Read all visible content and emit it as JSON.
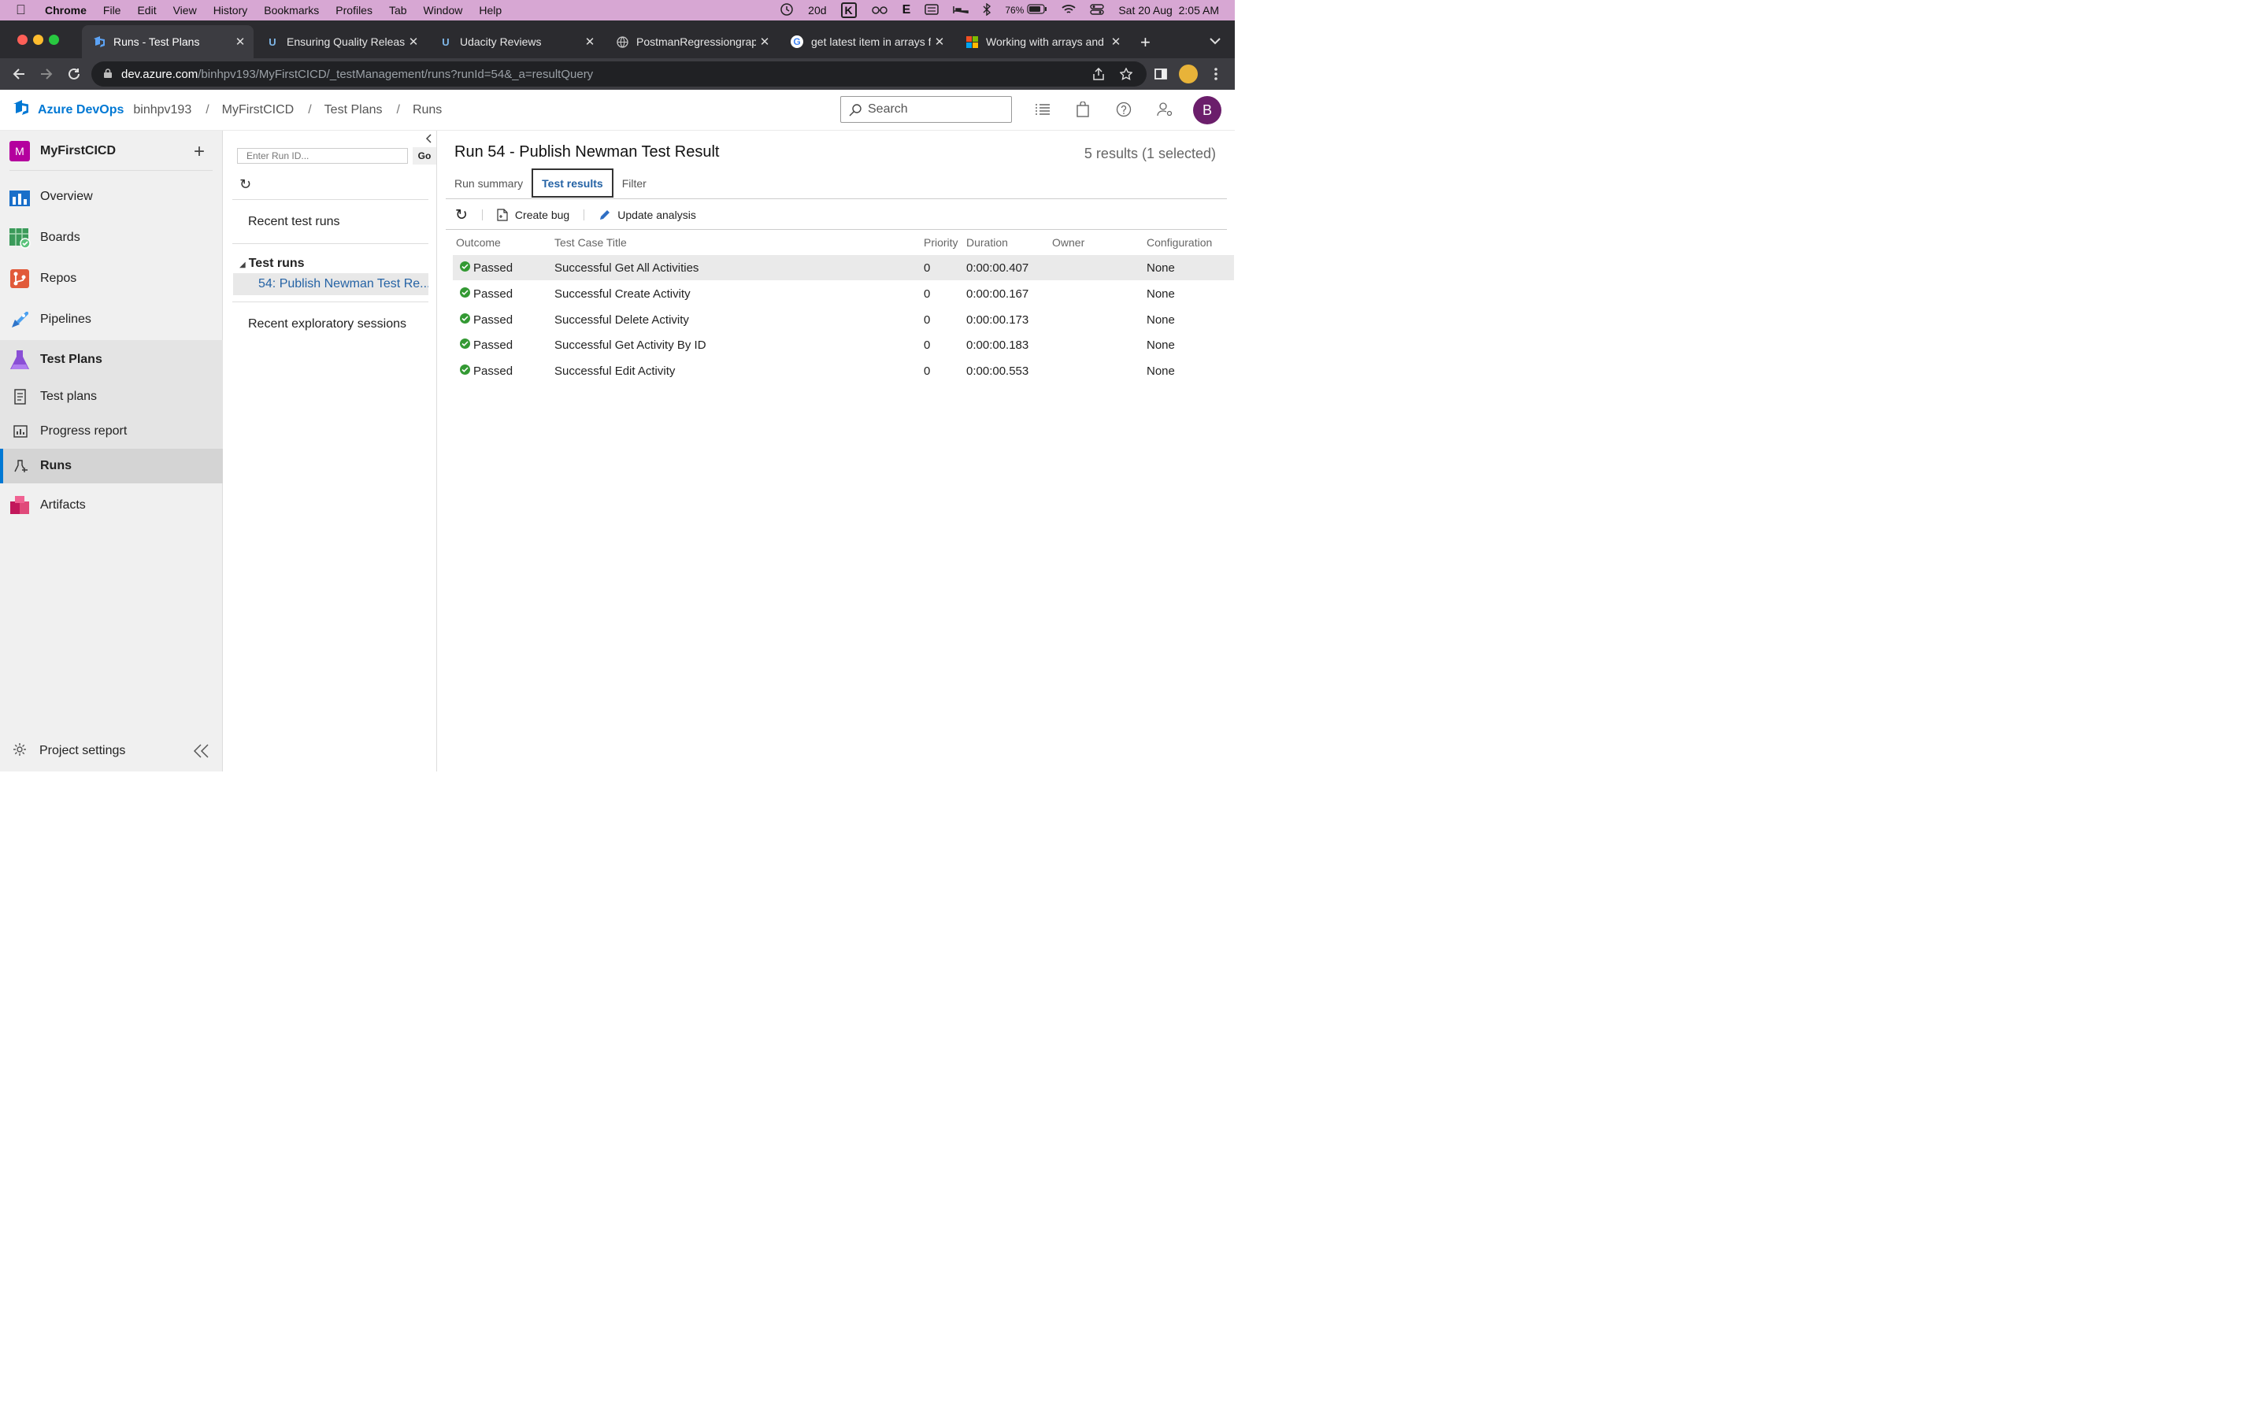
{
  "menubar": {
    "app": "Chrome",
    "items": [
      "File",
      "Edit",
      "View",
      "History",
      "Bookmarks",
      "Profiles",
      "Tab",
      "Window",
      "Help"
    ],
    "status_days": "20d",
    "status_k": "K",
    "status_e": "E",
    "battery": "76%",
    "clock": "Sat 20 Aug  2:05 AM"
  },
  "tabs": [
    {
      "title": "Runs - Test Plans",
      "icon": "azure-devops-icon"
    },
    {
      "title": "Ensuring Quality Release",
      "icon": "udacity-icon"
    },
    {
      "title": "Udacity Reviews",
      "icon": "udacity-icon"
    },
    {
      "title": "PostmanRegressiongraph",
      "icon": "globe-icon"
    },
    {
      "title": "get latest item in arrays f",
      "icon": "google-icon"
    },
    {
      "title": "Working with arrays and",
      "icon": "microsoft-icon"
    }
  ],
  "address": {
    "host": "dev.azure.com",
    "path": "/binhpv193/MyFirstCICD/_testManagement/runs?runId=54&_a=resultQuery"
  },
  "header": {
    "brand": "Azure DevOps",
    "org": "binhpv193",
    "project": "MyFirstCICD",
    "section": "Test Plans",
    "page": "Runs",
    "search_placeholder": "Search",
    "avatar_letter": "B"
  },
  "nav": {
    "project_badge": "M",
    "project_name": "MyFirstCICD",
    "items": {
      "overview": "Overview",
      "boards": "Boards",
      "repos": "Repos",
      "pipelines": "Pipelines",
      "test_plans": "Test Plans",
      "test_plans_sub": "Test plans",
      "progress_report": "Progress report",
      "runs": "Runs",
      "artifacts": "Artifacts"
    },
    "project_settings": "Project settings"
  },
  "runs_panel": {
    "run_id_placeholder": "Enter Run ID...",
    "go_label": "Go",
    "recent_runs": "Recent test runs",
    "test_runs_group": "Test runs",
    "selected_run": "54: Publish Newman Test Re...",
    "recent_exploratory": "Recent exploratory sessions"
  },
  "main": {
    "title": "Run 54 - Publish Newman Test Result",
    "results_count": "5 results (1 selected)",
    "tabs": [
      "Run summary",
      "Test results",
      "Filter"
    ],
    "toolbar": {
      "create_bug": "Create bug",
      "update_analysis": "Update analysis"
    },
    "columns": [
      "Outcome",
      "Test Case Title",
      "Priority",
      "Duration",
      "Owner",
      "Configuration"
    ],
    "rows": [
      {
        "outcome": "Passed",
        "title": "Successful Get All Activities",
        "priority": "0",
        "duration": "0:00:00.407",
        "owner": "",
        "configuration": "None"
      },
      {
        "outcome": "Passed",
        "title": "Successful Create Activity",
        "priority": "0",
        "duration": "0:00:00.167",
        "owner": "",
        "configuration": "None"
      },
      {
        "outcome": "Passed",
        "title": "Successful Delete Activity",
        "priority": "0",
        "duration": "0:00:00.173",
        "owner": "",
        "configuration": "None"
      },
      {
        "outcome": "Passed",
        "title": "Successful Get Activity By ID",
        "priority": "0",
        "duration": "0:00:00.183",
        "owner": "",
        "configuration": "None"
      },
      {
        "outcome": "Passed",
        "title": "Successful Edit Activity",
        "priority": "0",
        "duration": "0:00:00.553",
        "owner": "",
        "configuration": "None"
      }
    ]
  },
  "colors": {
    "menubar_bg": "#d7a7d3",
    "ado_blue": "#0078d4",
    "link_blue": "#2563a5",
    "passed_green": "#339933",
    "avatar_purple": "#6b1e6b"
  }
}
